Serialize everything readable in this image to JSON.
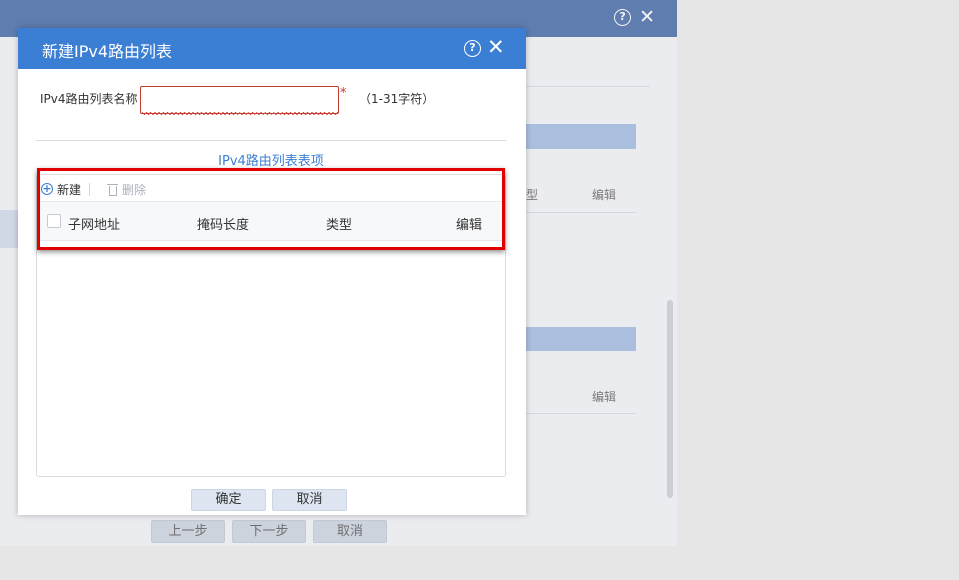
{
  "background": {
    "cells": [
      "型",
      "编辑",
      "编辑"
    ],
    "buttons": {
      "prev": "上一步",
      "next": "下一步",
      "cancel": "取消"
    }
  },
  "dialog": {
    "title": "新建IPv4路由列表",
    "help_icon": "?",
    "close_icon": "✕",
    "name_label": "IPv4路由列表名称",
    "name_value": "",
    "required_mark": "*",
    "name_hint": "（1-31字符）",
    "section_title": "IPv4路由列表表项",
    "toolbar": {
      "add_label": "新建",
      "delete_label": "删除"
    },
    "table": {
      "columns": [
        "子网地址",
        "掩码长度",
        "类型",
        "编辑"
      ],
      "rows": []
    },
    "footer": {
      "confirm_label": "确定",
      "cancel_label": "取消"
    }
  },
  "colors": {
    "dialog_header": "#3b7fd4",
    "background_titlebar": "#1c4a92",
    "highlight": "#e00000",
    "required": "#d1362a"
  }
}
